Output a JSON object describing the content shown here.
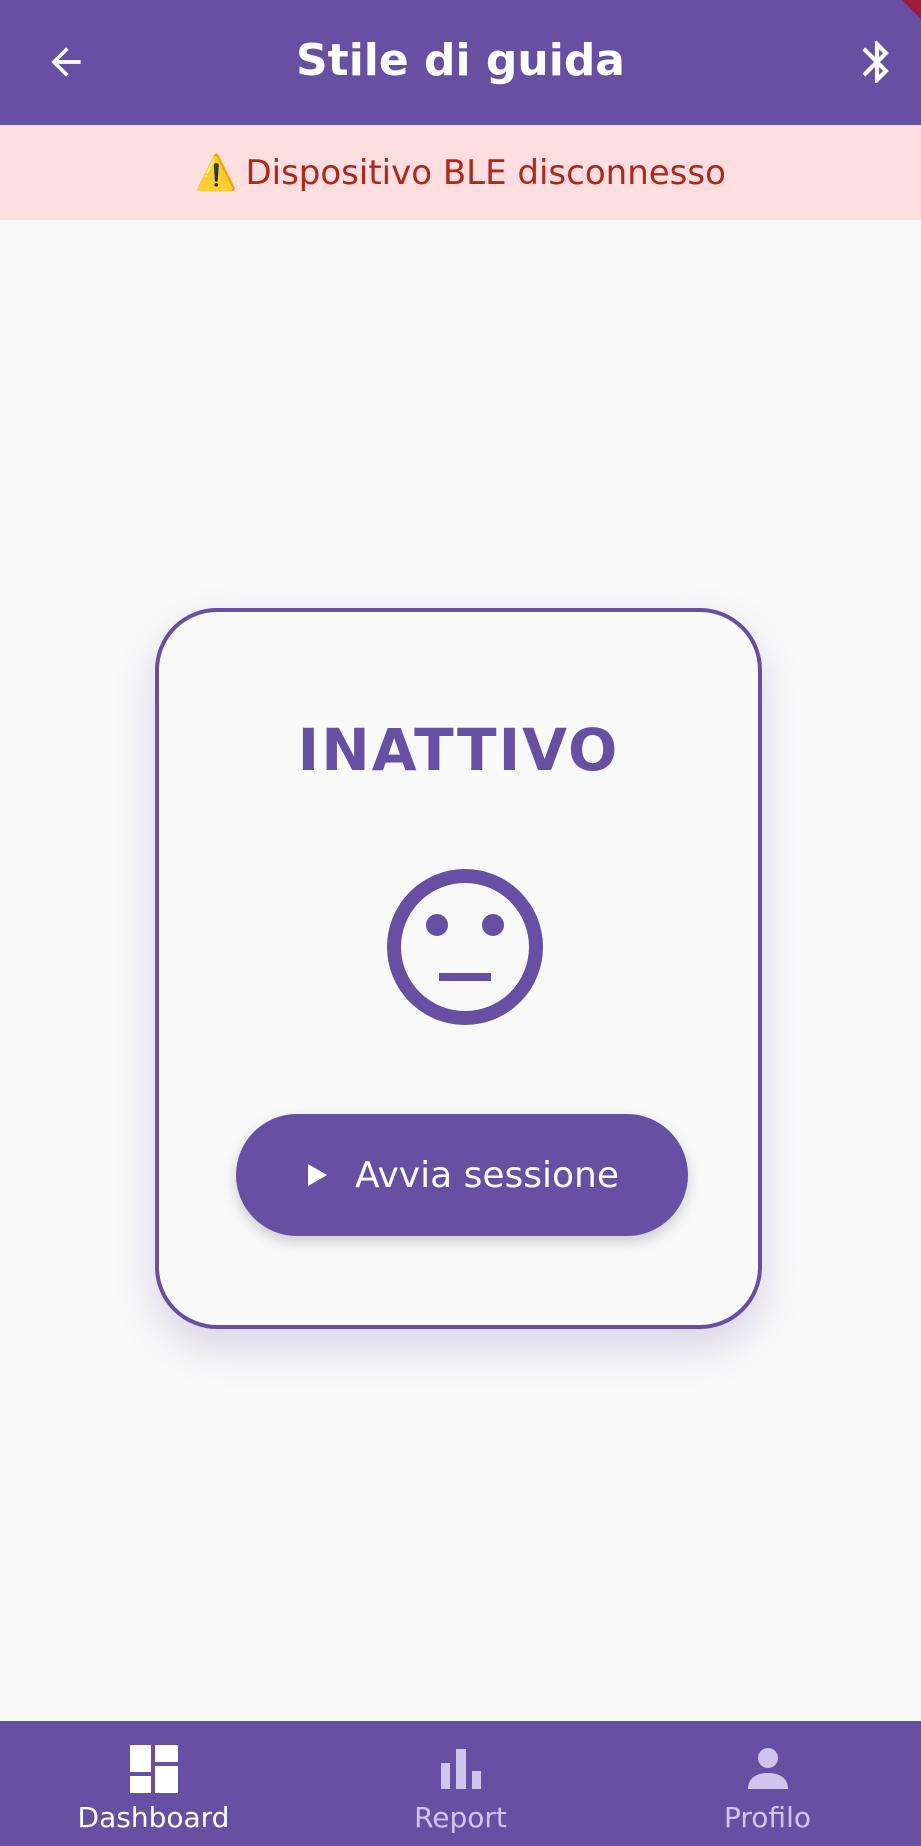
{
  "colors": {
    "primary": "#6750A4",
    "banner_bg": "#FFDEE0",
    "banner_text": "#B3261E",
    "inactive_nav": "#D0C4EC"
  },
  "app_bar": {
    "title": "Stile di guida",
    "back_icon": "arrow-back-icon",
    "action_icon": "bluetooth-icon"
  },
  "banner": {
    "icon": "warning-icon",
    "icon_glyph": "⚠️",
    "text": "Dispositivo BLE disconnesso"
  },
  "card": {
    "status": "INATTIVO",
    "face_icon": "neutral-face-icon",
    "button": {
      "icon": "play-icon",
      "label": "Avvia sessione"
    }
  },
  "bottom_nav": {
    "items": [
      {
        "label": "Dashboard",
        "icon": "dashboard-icon",
        "active": true
      },
      {
        "label": "Report",
        "icon": "bar-chart-icon",
        "active": false
      },
      {
        "label": "Profilo",
        "icon": "person-icon",
        "active": false
      }
    ]
  }
}
